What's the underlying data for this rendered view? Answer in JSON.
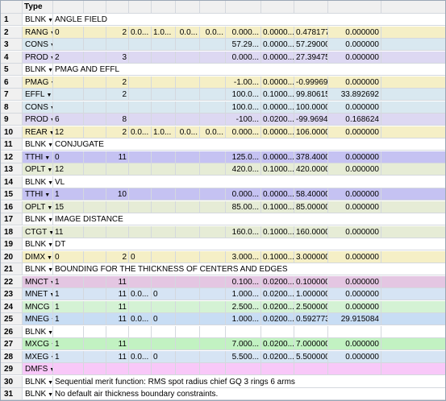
{
  "header": {
    "type_label": "Type"
  },
  "dropdown_glyph": "▼",
  "colors": {
    "BLNK": "#ffffff",
    "RANG": "#f5efc6",
    "CONS": "#d9e8f0",
    "PROD": "#ddd8f2",
    "PMAG": "#f5efc6",
    "EFFL": "#d9e8f0",
    "REAR": "#f5efc6",
    "TTHI": "#c5c2f2",
    "OPLT": "#e6ecd6",
    "CTGT": "#e6ecd6",
    "DIMX": "#f5efc6",
    "MNCT": "#e4c6e2",
    "MNET": "#d6e4f4",
    "MNCG": "#d4f2d4",
    "MNEG": "#c8ddf4",
    "MXCG": "#c2f2c2",
    "MXEG": "#d6e4f4",
    "DMFS": "#f8c8f8"
  },
  "rows": [
    {
      "n": "1",
      "type": "BLNK",
      "text": "ANGLE FIELD",
      "c": [
        "",
        "",
        "",
        "",
        "",
        "",
        "",
        "",
        "",
        ""
      ]
    },
    {
      "n": "2",
      "type": "RANG",
      "text": "",
      "c": [
        "0",
        "",
        "2",
        "0.0...",
        "1.0...",
        "0.0...",
        "0.0...",
        "0.000...",
        "0.0000...",
        "0.478177",
        "0.000000"
      ]
    },
    {
      "n": "3",
      "type": "CONS",
      "text": "",
      "c": [
        "",
        "",
        "",
        "",
        "",
        "",
        "",
        "57.29...",
        "0.0000...",
        "57.290000",
        "0.000000"
      ]
    },
    {
      "n": "4",
      "type": "PROD",
      "text": "",
      "c": [
        "2",
        "",
        "3",
        "",
        "",
        "",
        "",
        "0.000...",
        "0.0000...",
        "27.394755",
        "0.000000"
      ]
    },
    {
      "n": "5",
      "type": "BLNK",
      "text": "PMAG AND EFFL",
      "c": []
    },
    {
      "n": "6",
      "type": "PMAG",
      "text": "",
      "c": [
        "",
        "",
        "2",
        "",
        "",
        "",
        "",
        "-1.00...",
        "0.0000...",
        "-0.999694",
        "0.000000"
      ]
    },
    {
      "n": "7",
      "type": "EFFL",
      "text": "",
      "c": [
        "",
        "",
        "2",
        "",
        "",
        "",
        "",
        "100.0...",
        "0.1000...",
        "99.806153",
        "33.892692"
      ]
    },
    {
      "n": "8",
      "type": "CONS",
      "text": "",
      "c": [
        "",
        "",
        "",
        "",
        "",
        "",
        "",
        "100.0...",
        "0.0000...",
        "100.000000",
        "0.000000"
      ]
    },
    {
      "n": "9",
      "type": "PROD",
      "text": "",
      "c": [
        "6",
        "",
        "8",
        "",
        "",
        "",
        "",
        "-100...",
        "0.0200...",
        "-99.969426",
        "0.168624"
      ]
    },
    {
      "n": "10",
      "type": "REAR",
      "text": "",
      "c": [
        "12",
        "",
        "2",
        "0.0...",
        "1.0...",
        "0.0...",
        "0.0...",
        "0.000...",
        "0.0000...",
        "106.000000",
        "0.000000"
      ]
    },
    {
      "n": "11",
      "type": "BLNK",
      "text": "CONJUGATE",
      "c": []
    },
    {
      "n": "12",
      "type": "TTHI",
      "text": "",
      "c": [
        "0",
        "",
        "11",
        "",
        "",
        "",
        "",
        "125.0...",
        "0.0000...",
        "378.400000",
        "0.000000"
      ]
    },
    {
      "n": "13",
      "type": "OPLT",
      "text": "",
      "c": [
        "12",
        "",
        "",
        "",
        "",
        "",
        "",
        "420.0...",
        "0.1000...",
        "420.000000",
        "0.000000"
      ]
    },
    {
      "n": "14",
      "type": "BLNK",
      "text": "VL",
      "c": []
    },
    {
      "n": "15",
      "type": "TTHI",
      "text": "",
      "c": [
        "1",
        "",
        "10",
        "",
        "",
        "",
        "",
        "0.000...",
        "0.0000...",
        "58.400000",
        "0.000000"
      ]
    },
    {
      "n": "16",
      "type": "OPLT",
      "text": "",
      "c": [
        "15",
        "",
        "",
        "",
        "",
        "",
        "",
        "85.00...",
        "0.1000...",
        "85.000000",
        "0.000000"
      ]
    },
    {
      "n": "17",
      "type": "BLNK",
      "text": "IMAGE DISTANCE",
      "c": []
    },
    {
      "n": "18",
      "type": "CTGT",
      "text": "",
      "c": [
        "11",
        "",
        "",
        "",
        "",
        "",
        "",
        "160.0...",
        "0.1000...",
        "160.000000",
        "0.000000"
      ]
    },
    {
      "n": "19",
      "type": "BLNK",
      "text": "DT",
      "c": []
    },
    {
      "n": "20",
      "type": "DIMX",
      "text": "",
      "c": [
        "0",
        "",
        "2",
        "0",
        "",
        "",
        "",
        "3.000...",
        "0.1000...",
        "3.000000",
        "0.000000"
      ]
    },
    {
      "n": "21",
      "type": "BLNK",
      "text": "BOUNDING FOR THE THICKNESS OF CENTERS AND EDGES",
      "c": []
    },
    {
      "n": "22",
      "type": "MNCT",
      "text": "",
      "c": [
        "1",
        "",
        "11",
        "",
        "",
        "",
        "",
        "0.100...",
        "0.0200...",
        "0.100000",
        "0.000000"
      ]
    },
    {
      "n": "23",
      "type": "MNET",
      "text": "",
      "c": [
        "1",
        "",
        "11",
        "0.0...",
        "0",
        "",
        "",
        "1.000...",
        "0.0200...",
        "1.000000E...",
        "0.000000"
      ]
    },
    {
      "n": "24",
      "type": "MNCG",
      "text": "",
      "c": [
        "1",
        "",
        "11",
        "",
        "",
        "",
        "",
        "2.500...",
        "0.0200...",
        "2.500000",
        "0.000000"
      ]
    },
    {
      "n": "25",
      "type": "MNEG",
      "text": "",
      "c": [
        "1",
        "",
        "11",
        "0.0...",
        "0",
        "",
        "",
        "1.000...",
        "0.0200...",
        "0.592773",
        "29.915084"
      ]
    },
    {
      "n": "26",
      "type": "BLNK",
      "text": "",
      "c": []
    },
    {
      "n": "27",
      "type": "MXCG",
      "text": "",
      "c": [
        "1",
        "",
        "11",
        "",
        "",
        "",
        "",
        "7.000...",
        "0.0200...",
        "7.000000",
        "0.000000"
      ]
    },
    {
      "n": "28",
      "type": "MXEG",
      "text": "",
      "c": [
        "1",
        "",
        "11",
        "0.0...",
        "0",
        "",
        "",
        "5.500...",
        "0.0200...",
        "5.500000",
        "0.000000"
      ]
    },
    {
      "n": "29",
      "type": "DMFS",
      "text": "",
      "c": []
    },
    {
      "n": "30",
      "type": "BLNK",
      "text": "Sequential merit function: RMS spot radius chief GQ 3 rings 6 arms",
      "c": []
    },
    {
      "n": "31",
      "type": "BLNK",
      "text": "No default air thickness boundary constraints.",
      "c": []
    }
  ]
}
